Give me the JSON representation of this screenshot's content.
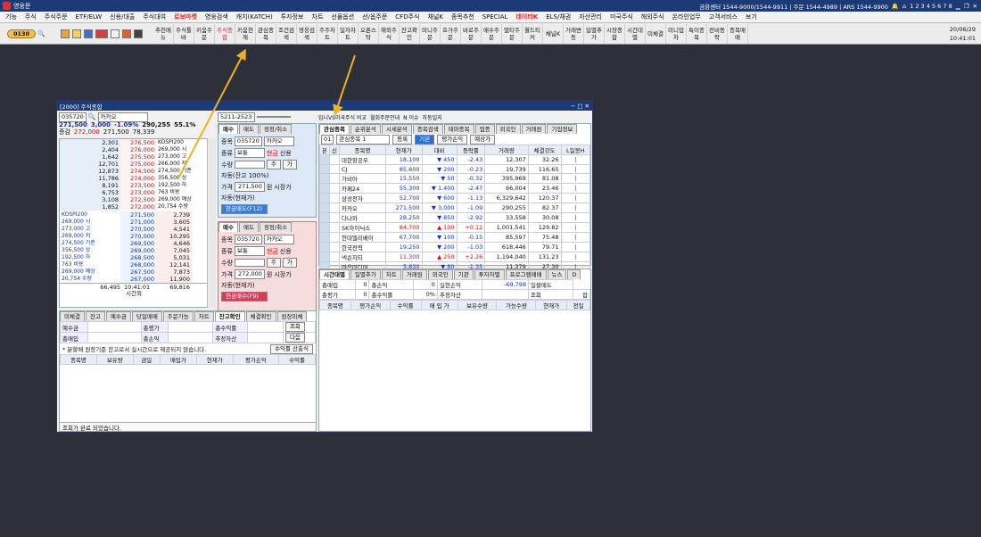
{
  "app": {
    "title": "영웅문"
  },
  "status": {
    "center": "금융센터 1544-9000/1544-9911 | 주문 1544-4989 | ARS 1544-9900",
    "pages": "1 2 3 4 5 6 7 8",
    "date": "20/06/29",
    "time": "10:41:01"
  },
  "menu": [
    "기능",
    "주식",
    "주식주문",
    "ETF/ELW",
    "신용/대출",
    "주식대여",
    "로보마켓",
    "영웅검색",
    "캐치(KATCH)",
    "투자정보",
    "차트",
    "선물옵션",
    "선/옵주문",
    "CFD주식",
    "채널K",
    "종목추천",
    "SPECIAL",
    "데이터K",
    "ELS/채권",
    "자산관리",
    "미국주식",
    "해외주식",
    "온라인업무",
    "고객서비스",
    "보기"
  ],
  "toolbar": {
    "code": "0130",
    "buttons": [
      "추천메뉴",
      "주식툴바",
      "키움주문",
      "주식종합",
      "키움현재",
      "관심종목",
      "조건검색",
      "영웅검색",
      "주주차트",
      "일자차트",
      "오픈스탁",
      "해외주식",
      "잔고확인",
      "미니주문",
      "호가주문",
      "바로주문",
      "매수주문",
      "멀티주문",
      "월드티커",
      "채널K",
      "거래변동",
      "일별추가",
      "시장종합",
      "시간대별",
      "미체결",
      "미니업차",
      "특이종목",
      "전비등락",
      "종목매매"
    ]
  },
  "window": {
    "title": "[2000] 주식종합",
    "toplinks": [
      "입니VS미국주식 비교",
      "월회주문안내",
      "N 이슈",
      "자동일지"
    ]
  },
  "quote": {
    "code": "035720",
    "name": "카카오",
    "price": "271,500",
    "change": "3,000",
    "rate": "-1.09%",
    "volume": "290,255",
    "ratio": "55.1%",
    "prev": "272,000",
    "open": "271,500",
    "amount": "78,339",
    "label_prev": "증감"
  },
  "orderbook_asks": [
    [
      "2,301",
      "276,500"
    ],
    [
      "2,404",
      "276,000"
    ],
    [
      "1,642",
      "275,500"
    ],
    [
      "12,701",
      "275,000"
    ],
    [
      "12,873",
      "274,500"
    ],
    [
      "11,786",
      "274,000"
    ],
    [
      "8,191",
      "273,500"
    ],
    [
      "6,753",
      "273,000"
    ],
    [
      "3,108",
      "272,500"
    ],
    [
      "1,852",
      "272,000"
    ]
  ],
  "orderbook_bids": [
    [
      "271,500",
      "2,739"
    ],
    [
      "271,000",
      "3,605"
    ],
    [
      "270,500",
      "4,541"
    ],
    [
      "270,000",
      "10,295"
    ],
    [
      "269,500",
      "4,646"
    ],
    [
      "269,000",
      "7,045"
    ],
    [
      "268,500",
      "5,031"
    ],
    [
      "268,000",
      "12,141"
    ],
    [
      "267,500",
      "7,873"
    ],
    [
      "267,000",
      "11,900"
    ]
  ],
  "orderbook_info": [
    "KOSPI200",
    "269,000 시",
    "273,000 고",
    "266,000 저",
    "274,500 기준",
    "356,500 상",
    "192,500 하",
    "763 비용",
    "269,000 예상",
    "20,754 수량",
    "▼ 5,500 -2.00%"
  ],
  "orderbook_info2": [
    "KOSPI200",
    "269,000 시",
    "273,000 고",
    "269,000 저",
    "274,500 기준",
    "356,500 상",
    "192,500 하",
    "763 비용",
    "269,000 예상",
    "20,754 수량",
    "▼ 5,500 -2.00%"
  ],
  "orderbook_total": {
    "ask": "66,495",
    "time": "10:41:01",
    "bid": "69,816",
    "label": "시간외"
  },
  "order_buy": {
    "tabs": [
      "매수",
      "매도",
      "정정/취소"
    ],
    "account": "5211-2523",
    "code": "035720",
    "name": "카카오",
    "type": "보통",
    "cash": "현금",
    "credit": "신용",
    "qty_label": "수량",
    "auto": "자동(잔고 100%)",
    "price_label": "가격",
    "price": "271,500",
    "unit": "원",
    "market": "시장가",
    "auto2": "자동(현재가)",
    "button": "현금매도(F12)"
  },
  "order_sell": {
    "tabs": [
      "매수",
      "매도",
      "정정/취소"
    ],
    "code": "035720",
    "name": "카카오",
    "type": "보통",
    "cash": "현금",
    "credit": "신용",
    "qty_label": "수량",
    "price_label": "가격",
    "price": "272,000",
    "unit": "원",
    "market": "시장가",
    "auto2": "자동(현재가)",
    "button": "현금매수(F9)"
  },
  "order_labels": {
    "code": "종목",
    "type": "종류",
    "qty": "수량",
    "price": "가격",
    "jo": "주",
    "ga": "가",
    "mi": "미수"
  },
  "bottom_left": {
    "tabs": [
      "미체결",
      "잔고",
      "예수금",
      "당일매매",
      "주문가능",
      "차트",
      "잔고확인",
      "체결확인",
      "원장미체"
    ],
    "rows": [
      [
        "예수금",
        "",
        "총평가",
        ""
      ],
      [
        "총매입",
        "",
        "총손익",
        ""
      ]
    ],
    "labels2": [
      "총수익률",
      "추정자산"
    ],
    "btns": [
      "조회",
      "다음"
    ],
    "note": "* 분할매 원장기준 잔고로서 실시간으로 제공되지 않습니다.",
    "calc_btn": "수익률 산출식",
    "cols": [
      "종목명",
      "보유량",
      "금일",
      "매입가",
      "현재가",
      "평가손익",
      "수익률"
    ],
    "status": "조회가 완료 되었습니다."
  },
  "watch": {
    "tabs": [
      "관심종목",
      "순위분석",
      "시세분석",
      "종목검색",
      "테마종목",
      "업종",
      "외국인",
      "거래원",
      "기업정보"
    ],
    "group_no": "01",
    "group_name": "관심종목 1",
    "btn_reg": "등록",
    "btn_basic": "기본",
    "btn_eval": "평가손익",
    "btn_expect": "예상가",
    "cols": [
      "본",
      "신",
      "종목명",
      "현재가",
      "대비",
      "등락률",
      "거래량",
      "체결강도",
      "L일봉H"
    ],
    "rows": [
      [
        "대한항공우",
        "18,100",
        "▼",
        "450",
        "-2.43",
        "12,307",
        "32.26",
        "b"
      ],
      [
        "CJ",
        "85,600",
        "▼",
        "200",
        "-0.23",
        "19,739",
        "116.65",
        "b"
      ],
      [
        "가비아",
        "15,550",
        "▼",
        "50",
        "-0.32",
        "395,969",
        "81.08",
        "b"
      ],
      [
        "카페24",
        "55,300",
        "▼",
        "1,400",
        "-2.47",
        "66,004",
        "23.46",
        "b"
      ],
      [
        "삼성전자",
        "52,700",
        "▼",
        "600",
        "-1.13",
        "6,329,642",
        "120.37",
        "b"
      ],
      [
        "카카오",
        "271,500",
        "▼",
        "3,000",
        "-1.09",
        "290,255",
        "82.37",
        "b"
      ],
      [
        "다나와",
        "28,250",
        "▼",
        "850",
        "-2.92",
        "33,558",
        "30.08",
        "b"
      ],
      [
        "SK하이닉스",
        "84,700",
        "▲",
        "100",
        "+0.12",
        "1,001,541",
        "129.82",
        "r"
      ],
      [
        "현대엘리베이",
        "67,700",
        "▼",
        "100",
        "-0.15",
        "85,597",
        "75.48",
        "b"
      ],
      [
        "한국전력",
        "19,250",
        "▼",
        "200",
        "-1.03",
        "618,446",
        "79.71",
        "b"
      ],
      [
        "넥슨지티",
        "11,300",
        "▲",
        "250",
        "+2.26",
        "1,194,040",
        "131.23",
        "r"
      ],
      [
        "마음미디어",
        "5,830",
        "▼",
        "80",
        "-1.35",
        "11,379",
        "27.30",
        "b"
      ]
    ]
  },
  "bottom_right": {
    "tabs": [
      "시간대별",
      "일별추가",
      "차트",
      "거래원",
      "외국인",
      "기관",
      "투자자별",
      "프로그램매매",
      "뉴스",
      "D"
    ],
    "r1": [
      "총매입",
      "0",
      "총손익",
      "0",
      "실현손익",
      "-69,798",
      "일괄매도"
    ],
    "r2": [
      "총평가",
      "0",
      "총수익률",
      "0%",
      "추정자산",
      "",
      "조회",
      "합"
    ],
    "cols": [
      "종목명",
      "평가손익",
      "수익률",
      "매 입 가",
      "보유수량",
      "가능수량",
      "현재가",
      "전일"
    ]
  }
}
